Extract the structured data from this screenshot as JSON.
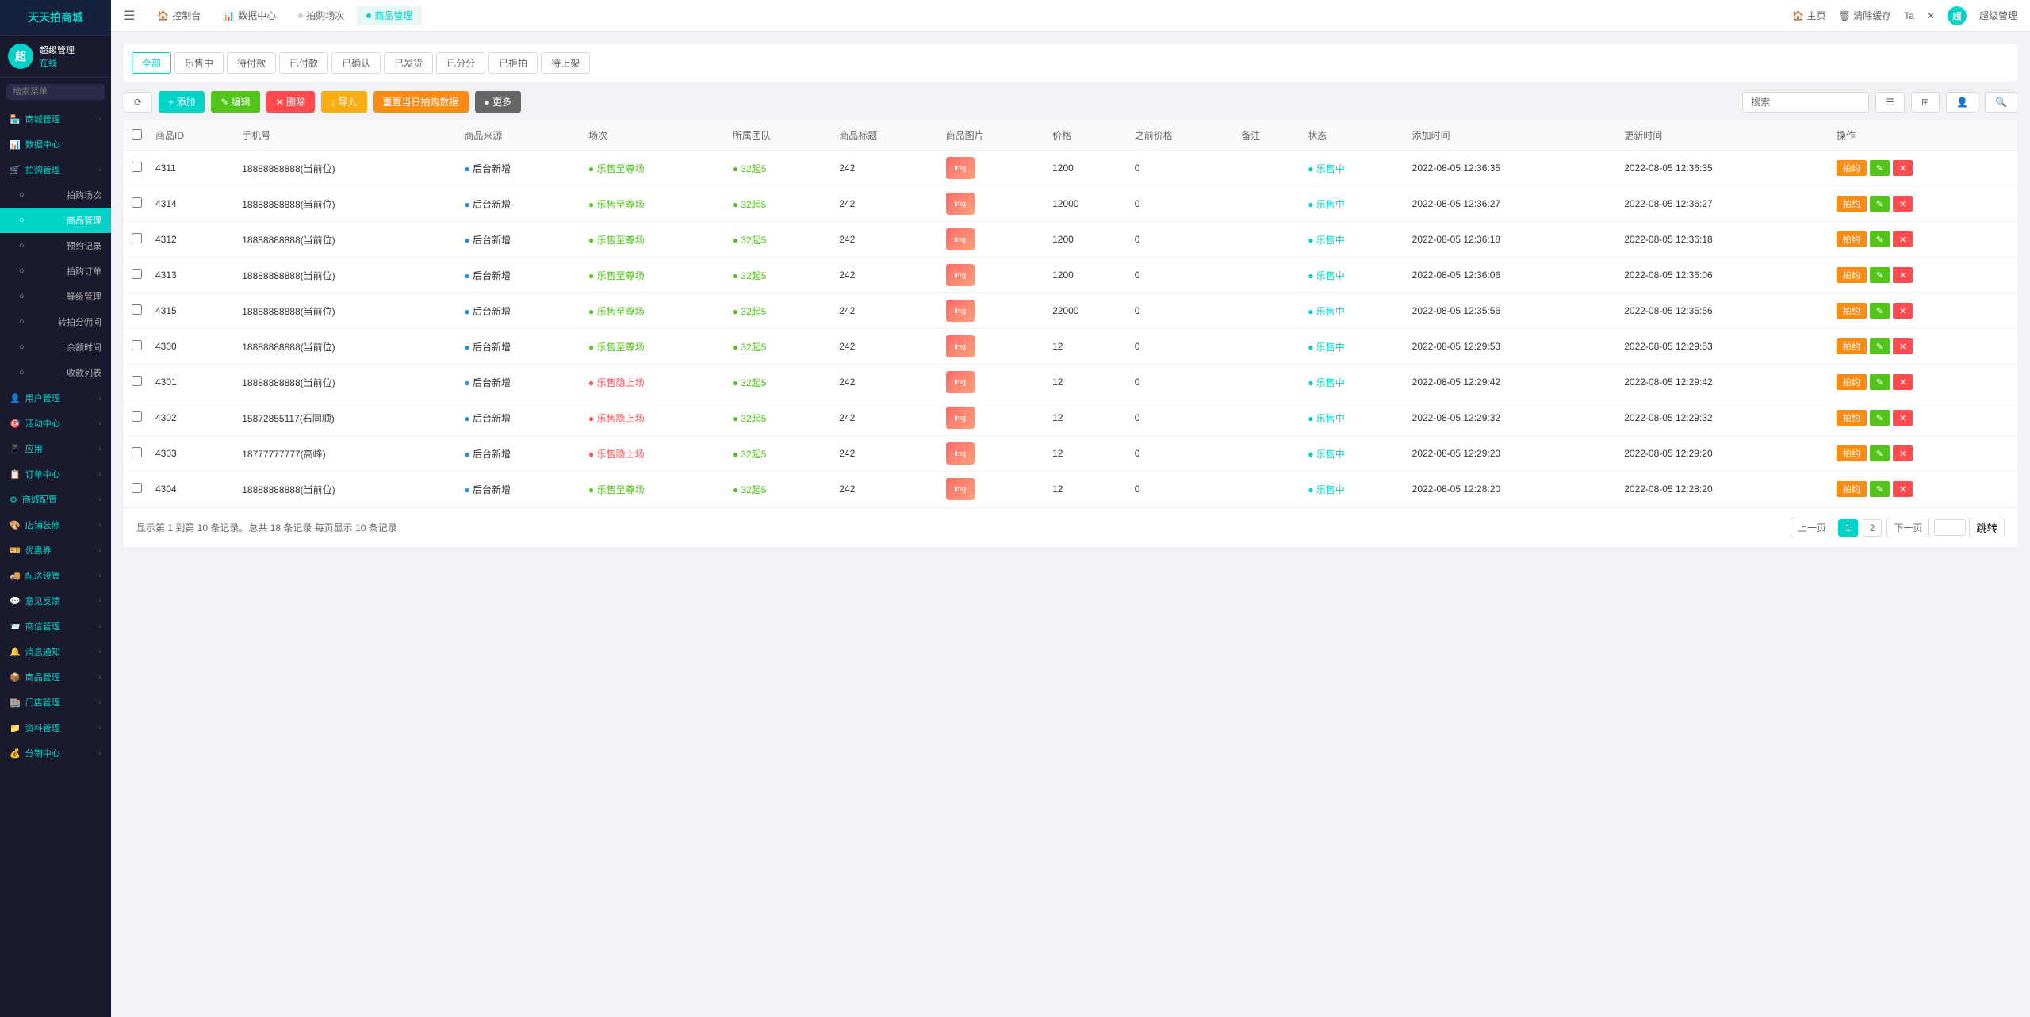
{
  "app": {
    "title": "天天拍商城"
  },
  "user": {
    "name": "超级管理",
    "status": "在线",
    "avatar_text": "超"
  },
  "sidebar_search": {
    "placeholder": "搜索菜单"
  },
  "topnav": {
    "tabs": [
      {
        "label": "控制台",
        "icon": "home",
        "active": false
      },
      {
        "label": "数据中心",
        "icon": "chart",
        "active": false
      },
      {
        "label": "拍购场次",
        "icon": "circle",
        "active": false
      },
      {
        "label": "商品管理",
        "icon": "circle",
        "active": true
      }
    ],
    "right_links": [
      {
        "label": "主页"
      },
      {
        "label": "清除缓存"
      },
      {
        "label": "Ta"
      }
    ],
    "user_label": "超级管理"
  },
  "filter_tabs": [
    {
      "label": "全部",
      "active": true
    },
    {
      "label": "乐售中",
      "active": false
    },
    {
      "label": "待付款",
      "active": false
    },
    {
      "label": "已付款",
      "active": false
    },
    {
      "label": "已确认",
      "active": false
    },
    {
      "label": "已发货",
      "active": false
    },
    {
      "label": "已分分",
      "active": false
    },
    {
      "label": "已拒拍",
      "active": false
    },
    {
      "label": "待上架",
      "active": false
    }
  ],
  "toolbar": {
    "refresh_label": "⟳",
    "add_label": "+ 添加",
    "edit_label": "✎ 编辑",
    "delete_label": "✕ 删除",
    "import_label": "↓ 导入",
    "today_label": "重置当日拍购数据",
    "more_label": "● 更多",
    "search_placeholder": "搜索"
  },
  "table": {
    "columns": [
      "商品ID",
      "手机号",
      "商品来源",
      "场次",
      "所属团队",
      "商品标题",
      "商品图片",
      "价格",
      "之前价格",
      "备注",
      "状态",
      "添加时间",
      "更新时间",
      "操作"
    ],
    "rows": [
      {
        "id": "4311",
        "phone": "18888888888(当前位)",
        "source": "后台新增",
        "session": "乐售至尊场",
        "session_color": "green",
        "team": "32起5",
        "team_color": "green",
        "title": "242",
        "price": "1200",
        "prev_price": "0",
        "note": "",
        "status": "乐售中",
        "status_color": "teal",
        "add_time": "2022-08-05 12:36:35",
        "update_time": "2022-08-05 12:36:35"
      },
      {
        "id": "4314",
        "phone": "18888888888(当前位)",
        "source": "后台新增",
        "session": "乐售至尊场",
        "session_color": "green",
        "team": "32起5",
        "team_color": "green",
        "title": "242",
        "price": "12000",
        "prev_price": "0",
        "note": "",
        "status": "乐售中",
        "status_color": "teal",
        "add_time": "2022-08-05 12:36:27",
        "update_time": "2022-08-05 12:36:27"
      },
      {
        "id": "4312",
        "phone": "18888888888(当前位)",
        "source": "后台新增",
        "session": "乐售至尊场",
        "session_color": "green",
        "team": "32起5",
        "team_color": "green",
        "title": "242",
        "price": "1200",
        "prev_price": "0",
        "note": "",
        "status": "乐售中",
        "status_color": "teal",
        "add_time": "2022-08-05 12:36:18",
        "update_time": "2022-08-05 12:36:18"
      },
      {
        "id": "4313",
        "phone": "18888888888(当前位)",
        "source": "后台新增",
        "session": "乐售至尊场",
        "session_color": "green",
        "team": "32起5",
        "team_color": "green",
        "title": "242",
        "price": "1200",
        "prev_price": "0",
        "note": "",
        "status": "乐售中",
        "status_color": "teal",
        "add_time": "2022-08-05 12:36:06",
        "update_time": "2022-08-05 12:36:06"
      },
      {
        "id": "4315",
        "phone": "18888888888(当前位)",
        "source": "后台新增",
        "session": "乐售至尊场",
        "session_color": "green",
        "team": "32起5",
        "team_color": "green",
        "title": "242",
        "price": "22000",
        "prev_price": "0",
        "note": "",
        "status": "乐售中",
        "status_color": "teal",
        "add_time": "2022-08-05 12:35:56",
        "update_time": "2022-08-05 12:35:56"
      },
      {
        "id": "4300",
        "phone": "18888888888(当前位)",
        "source": "后台新增",
        "session": "乐售至尊场",
        "session_color": "green",
        "team": "32起5",
        "team_color": "green",
        "title": "242",
        "price": "12",
        "prev_price": "0",
        "note": "",
        "status": "乐售中",
        "status_color": "teal",
        "add_time": "2022-08-05 12:29:53",
        "update_time": "2022-08-05 12:29:53"
      },
      {
        "id": "4301",
        "phone": "18888888888(当前位)",
        "source": "后台新增",
        "session": "乐售隐上场",
        "session_color": "red",
        "team": "32起5",
        "team_color": "green",
        "title": "242",
        "price": "12",
        "prev_price": "0",
        "note": "",
        "status": "乐售中",
        "status_color": "teal",
        "add_time": "2022-08-05 12:29:42",
        "update_time": "2022-08-05 12:29:42"
      },
      {
        "id": "4302",
        "phone": "15872855117(石同顺)",
        "source": "后台新增",
        "session": "乐售隐上场",
        "session_color": "red",
        "team": "32起5",
        "team_color": "green",
        "title": "242",
        "price": "12",
        "prev_price": "0",
        "note": "",
        "status": "乐售中",
        "status_color": "teal",
        "add_time": "2022-08-05 12:29:32",
        "update_time": "2022-08-05 12:29:32"
      },
      {
        "id": "4303",
        "phone": "18777777777(高峰)",
        "source": "后台新增",
        "session": "乐售隐上场",
        "session_color": "red",
        "team": "32起5",
        "team_color": "green",
        "title": "242",
        "price": "12",
        "prev_price": "0",
        "note": "",
        "status": "乐售中",
        "status_color": "teal",
        "add_time": "2022-08-05 12:29:20",
        "update_time": "2022-08-05 12:29:20"
      },
      {
        "id": "4304",
        "phone": "18888888888(当前位)",
        "source": "后台新增",
        "session": "乐售至尊场",
        "session_color": "green",
        "team": "32起5",
        "team_color": "green",
        "title": "242",
        "price": "12",
        "prev_price": "0",
        "note": "",
        "status": "乐售中",
        "status_color": "teal",
        "add_time": "2022-08-05 12:28:20",
        "update_time": "2022-08-05 12:28:20"
      }
    ],
    "action_edit": "拍约",
    "action_pencil": "✎",
    "action_del": "✕"
  },
  "pagination": {
    "info": "显示第 1 到第 10 条记录。总共 18 条记录 每页显示",
    "per_page": "10",
    "per_page_suffix": "条记录",
    "prev_label": "上一页",
    "next_label": "下一页",
    "jump_label": "跳转",
    "pages": [
      "1",
      "2"
    ],
    "current_page": "1"
  },
  "sidebar": {
    "menu": [
      {
        "label": "商城管理",
        "icon": "🏪",
        "has_arrow": true,
        "active": false
      },
      {
        "label": "数据中心",
        "icon": "📊",
        "has_arrow": false,
        "active": false
      },
      {
        "label": "拍购管理",
        "icon": "🛒",
        "has_arrow": true,
        "active": false
      },
      {
        "label": "拍购场次",
        "icon": "○",
        "has_arrow": false,
        "sub": true,
        "active": false
      },
      {
        "label": "商品管理",
        "icon": "○",
        "has_arrow": false,
        "sub": true,
        "active": true
      },
      {
        "label": "预约记录",
        "icon": "○",
        "has_arrow": false,
        "sub": true,
        "active": false
      },
      {
        "label": "拍购订单",
        "icon": "○",
        "has_arrow": false,
        "sub": true,
        "active": false
      },
      {
        "label": "等级管理",
        "icon": "○",
        "has_arrow": false,
        "sub": true,
        "active": false
      },
      {
        "label": "转拍分佣间",
        "icon": "○",
        "has_arrow": false,
        "sub": true,
        "active": false
      },
      {
        "label": "余额时间",
        "icon": "○",
        "has_arrow": false,
        "sub": true,
        "active": false
      },
      {
        "label": "收款列表",
        "icon": "○",
        "has_arrow": false,
        "sub": true,
        "active": false
      },
      {
        "label": "用户管理",
        "icon": "👤",
        "has_arrow": true,
        "active": false
      },
      {
        "label": "活动中心",
        "icon": "🎯",
        "has_arrow": true,
        "active": false
      },
      {
        "label": "应用",
        "icon": "📱",
        "has_arrow": true,
        "active": false
      },
      {
        "label": "订单中心",
        "icon": "📋",
        "has_arrow": true,
        "active": false
      },
      {
        "label": "商城配置",
        "icon": "⚙",
        "has_arrow": true,
        "active": false
      },
      {
        "label": "店铺装修",
        "icon": "🎨",
        "has_arrow": true,
        "active": false
      },
      {
        "label": "优惠券",
        "icon": "🎫",
        "has_arrow": true,
        "active": false
      },
      {
        "label": "配送设置",
        "icon": "🚚",
        "has_arrow": true,
        "active": false
      },
      {
        "label": "意见反馈",
        "icon": "💬",
        "has_arrow": true,
        "active": false
      },
      {
        "label": "商信管理",
        "icon": "📨",
        "has_arrow": true,
        "active": false
      },
      {
        "label": "消息通知",
        "icon": "🔔",
        "has_arrow": true,
        "active": false
      },
      {
        "label": "商品管理",
        "icon": "📦",
        "has_arrow": true,
        "active": false
      },
      {
        "label": "门店管理",
        "icon": "🏬",
        "has_arrow": true,
        "active": false
      },
      {
        "label": "资料管理",
        "icon": "📁",
        "has_arrow": true,
        "active": false
      },
      {
        "label": "分销中心",
        "icon": "💰",
        "has_arrow": true,
        "active": false
      }
    ]
  }
}
